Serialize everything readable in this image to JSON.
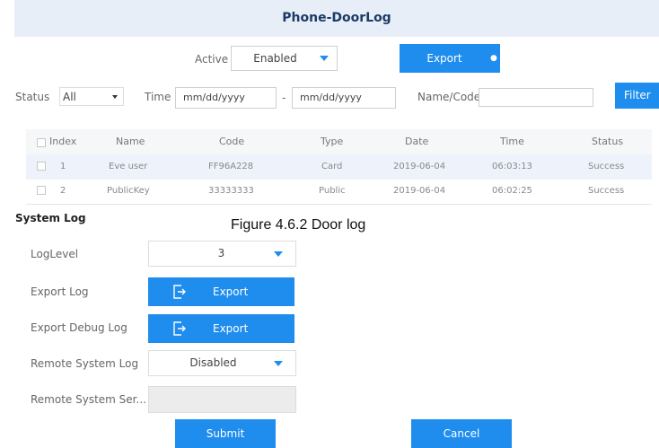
{
  "title": "Phone-DoorLog",
  "active": {
    "label": "Active",
    "value": "Enabled"
  },
  "export_top": {
    "label": "Export"
  },
  "filter": {
    "status_label": "Status",
    "status_value": "All",
    "time_label": "Time",
    "date_from_placeholder": "mm/dd/yyyy",
    "date_sep": "-",
    "date_to_placeholder": "mm/dd/yyyy",
    "namecode_label": "Name/Code",
    "namecode_value": "",
    "filter_button": "Filter"
  },
  "table": {
    "headers": [
      "Index",
      "Name",
      "Code",
      "Type",
      "Date",
      "Time",
      "Status"
    ],
    "rows": [
      {
        "index": "1",
        "name": "Eve user",
        "code": "FF96A228",
        "type": "Card",
        "date": "2019-06-04",
        "time": "06:03:13",
        "status": "Success"
      },
      {
        "index": "2",
        "name": "PublicKey",
        "code": "33333333",
        "type": "Public",
        "date": "2019-06-04",
        "time": "06:02:25",
        "status": "Success"
      }
    ]
  },
  "caption": "Figure 4.6.2 Door log",
  "system_log": {
    "title": "System Log",
    "loglevel_label": "LogLevel",
    "loglevel_value": "3",
    "export_log_label": "Export Log",
    "export_log_button": "Export",
    "export_debug_label": "Export Debug Log",
    "export_debug_button": "Export",
    "remote_log_label": "Remote System Log",
    "remote_log_value": "Disabled",
    "remote_server_label": "Remote System Ser...",
    "remote_server_value": "",
    "submit": "Submit",
    "cancel": "Cancel"
  },
  "colors": {
    "accent": "#1f8ded",
    "header_bg": "#e8eef7",
    "title_text": "#1b3a66"
  }
}
